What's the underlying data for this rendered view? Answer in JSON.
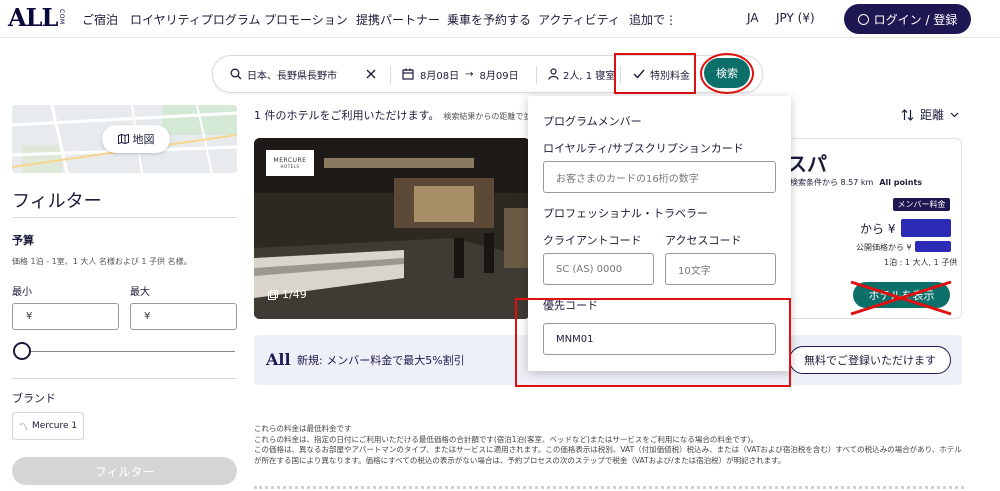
{
  "nav": {
    "logo_big": "ALL",
    "logo_small": "COM",
    "items": [
      "ご宿泊",
      "ロイヤリティプログラム",
      "プロモーション",
      "提携パートナー",
      "乗車を予約する",
      "アクティビティ",
      "追加で⋮"
    ],
    "lang": "JA",
    "currency": "JPY (¥)",
    "login_label": "ログイン / 登録"
  },
  "search": {
    "destination": "日本、長野県長野市",
    "checkin": "8月08日",
    "arrow": "→",
    "checkout": "8月09日",
    "guests": "2人, 1 寝室",
    "special_rate": "特別料金",
    "search_label": "検索"
  },
  "sidebar": {
    "map_label": "地図",
    "filter_title": "フィルター",
    "budget_label": "予算",
    "budget_note": "価格 1泊 - 1室、1 大人 名様および 1 子供 名様。",
    "min_label": "最小",
    "max_label": "最大",
    "currency_symbol_min": "¥",
    "currency_symbol_max": "¥",
    "brand_label": "ブランド",
    "brand_chip": "Mercure 1",
    "filter_button": "フィルター"
  },
  "results": {
    "count_text": "1 件のホテルをご利用いただけます。",
    "count_sub": "検索結果からの距離で並",
    "sort_label": "距離",
    "hotel": {
      "brand_badge_top": "MERCURE",
      "brand_badge_bottom": "HOTELS",
      "photo_count": "1/49",
      "name_part": "スパ",
      "distance": "検索条件から 8.57 km",
      "points": "All points",
      "member_tag": "メンバー料金",
      "from_label": "から ¥",
      "public_price_label": "公開価格から ¥",
      "per_person": "1泊 : 1 大人, 1 子供",
      "view_button": "ホテルを表示"
    },
    "promo": {
      "logo": "All",
      "text": "新規: メンバー料金で最大5%割引",
      "button": "無料でご登録いただけます"
    },
    "disclaimer": [
      "これらの料金は最低料金です",
      "これらの料金は、指定の日付にご利用いただける最低価格の合計額です(宿泊1泊(客室、ベッドなど)またはサービスをご利用になる場合の料金です)。",
      "この価格は、異なるお部屋やアパートマンのタイプ、またはサービスに適用されます。この価格表示は税別、VAT（付加価値税）税込み、または（VATおよび宿泊税を含む）すべての税込みの場合があり、ホテルが所在する国により異なります。価格にすべての税込の表示がない場合は、予約プロセスの次のステップで税金（VATおよび/または宿泊税）が明記されます。"
    ]
  },
  "panel": {
    "program_member": "プログラムメンバー",
    "loyalty_card_label": "ロイヤルティ/サブスクリプションカード",
    "loyalty_card_placeholder": "お客さまのカードの16桁の数字",
    "pro_traveler": "プロフェッショナル・トラベラー",
    "client_code_label": "クライアントコード",
    "client_code_placeholder": "SC (AS) 0000",
    "access_code_label": "アクセスコード",
    "access_code_placeholder": "10文字",
    "promo_code_label": "優先コード",
    "promo_code_value": "MNM01"
  },
  "colors": {
    "brand_navy": "#1e1852",
    "search_teal": "#0c6f6a",
    "annotation_red": "#e01010",
    "redaction_blue": "#2b2bb6"
  }
}
